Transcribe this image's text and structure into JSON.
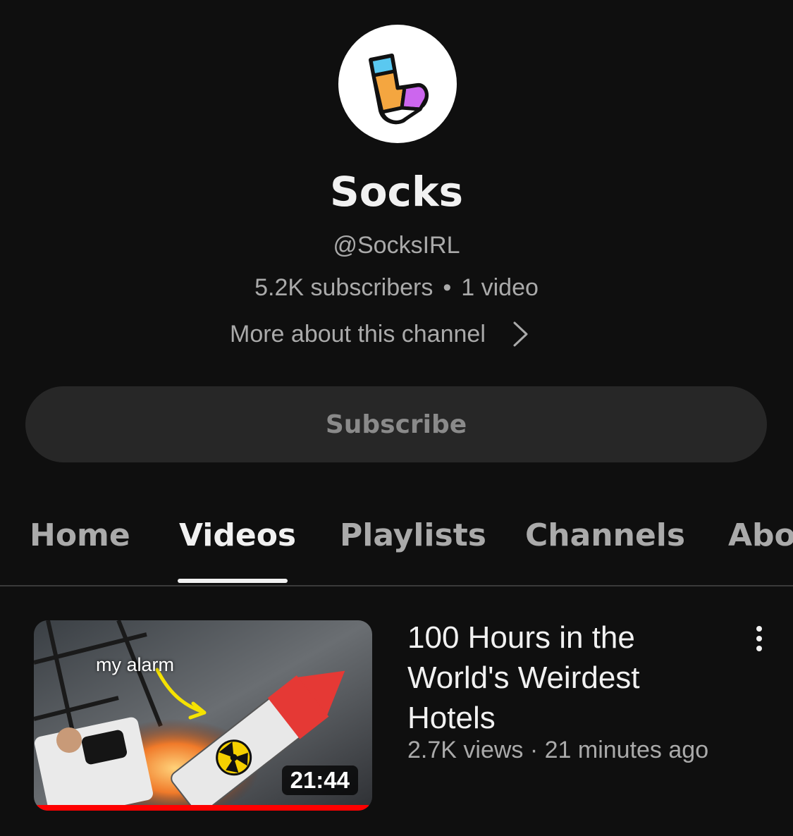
{
  "channel": {
    "avatar_icon": "sock-logo-icon",
    "name": "Socks",
    "handle": "@SocksIRL",
    "subscribers": "5.2K subscribers",
    "separator": "•",
    "video_count": "1 video",
    "more_about": "More about this channel"
  },
  "subscribe": {
    "label": "Subscribe"
  },
  "tabs": [
    {
      "label": "Home",
      "active": false
    },
    {
      "label": "Videos",
      "active": true
    },
    {
      "label": "Playlists",
      "active": false
    },
    {
      "label": "Channels",
      "active": false
    },
    {
      "label": "About",
      "active": false
    }
  ],
  "videos": [
    {
      "title": "100 Hours in the World's Weirdest Hotels",
      "meta": "2.7K views · 21 minutes ago",
      "duration": "21:44",
      "thumbnail_caption": "my alarm",
      "watch_progress": 0.99
    }
  ],
  "colors": {
    "background": "#0f0f0f",
    "primary_text": "#f1f1f1",
    "secondary_text": "#aaaaaa",
    "subscribe_bg": "#272727",
    "progress_red": "#ff0000"
  }
}
